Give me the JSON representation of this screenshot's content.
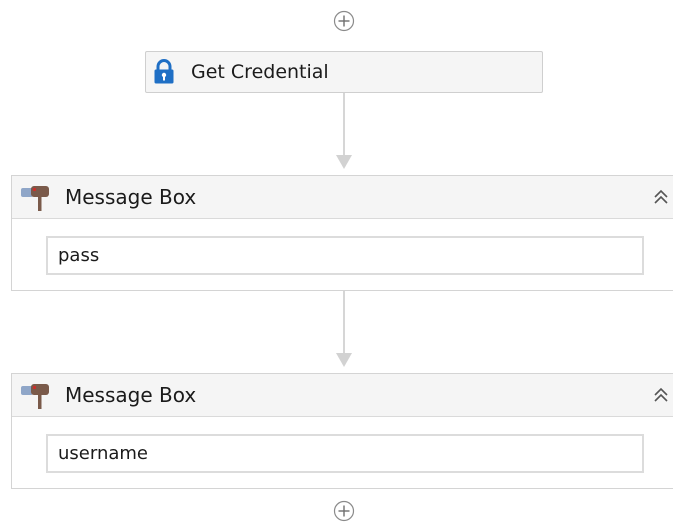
{
  "workflow": {
    "activities": [
      {
        "title": "Get Credential",
        "icon": "lock-icon",
        "accent": "#1f6fc5"
      },
      {
        "title": "Message Box",
        "icon": "message-box-icon",
        "text_value": "pass"
      },
      {
        "title": "Message Box",
        "icon": "message-box-icon",
        "text_value": "username"
      }
    ],
    "colors": {
      "connector": "#d6d6d6",
      "header_bg": "#f5f5f5",
      "border": "#d4d4d4",
      "lock": "#1f6fc5",
      "mailbox": "#7a5a4a"
    }
  }
}
